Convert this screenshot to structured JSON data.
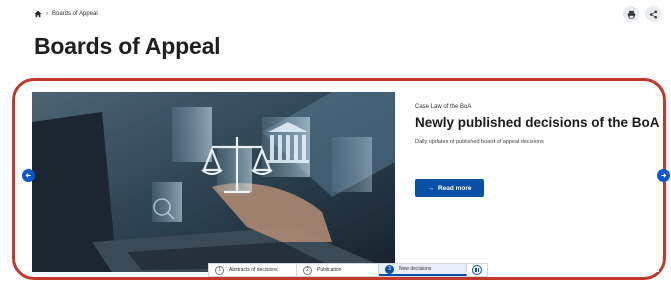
{
  "breadcrumb": {
    "home_icon": "home-icon",
    "current": "Boards of Appeal"
  },
  "actions": {
    "print_icon": "print-icon",
    "share_icon": "share-icon"
  },
  "page": {
    "title": "Boards of Appeal"
  },
  "slide": {
    "kicker": "Case Law of the BoA",
    "title": "Newly published decisions of the BoA",
    "description": "Daily updates of published board of appeal decisions",
    "button_label": "Read more",
    "image_alt": "justice-scales-laptop-image"
  },
  "carousel": {
    "tabs": [
      {
        "num": "1",
        "label": "Abstracts of decisions"
      },
      {
        "num": "2",
        "label": "Publication"
      },
      {
        "num": "3",
        "label": "New decisions"
      }
    ],
    "active_tab": 3,
    "accent": "#0a4fa6",
    "highlight": "#c0392b"
  }
}
